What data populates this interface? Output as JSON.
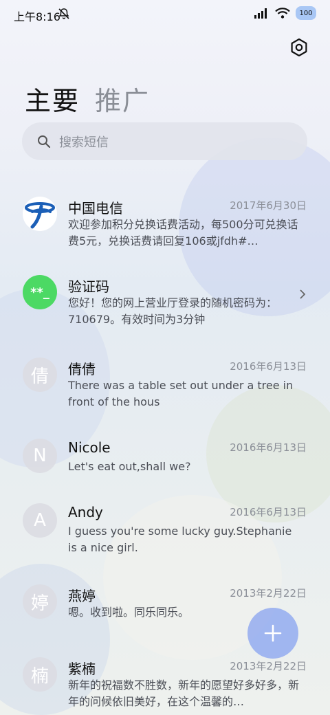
{
  "status_bar": {
    "time": "上午8:16",
    "battery": "100"
  },
  "tabs": [
    {
      "label": "主要"
    },
    {
      "label": "推广"
    }
  ],
  "search": {
    "placeholder": "搜索短信"
  },
  "conversations": [
    {
      "name": "中国电信",
      "date": "2017年6月30日",
      "preview": "欢迎参加积分兑换话费活动，每500分可兑换话费5元，兑换话费请回复106或jfdh#…",
      "avatar": "china-telecom-logo"
    },
    {
      "name": "验证码",
      "date": "",
      "preview": "您好！您的网上营业厅登录的随机密码为：710679。有效时间为3分钟",
      "avatar_text": "**_"
    },
    {
      "name": "倩倩",
      "date": "2016年6月13日",
      "preview": "There was a table set out under a tree in front of the hous",
      "avatar_text": "倩"
    },
    {
      "name": "Nicole",
      "date": "2016年6月13日",
      "preview": "Let's eat out,shall we?",
      "avatar_text": "N"
    },
    {
      "name": "Andy",
      "date": "2016年6月13日",
      "preview": "I guess you're some lucky guy.Stephanie is a nice girl.",
      "avatar_text": "A"
    },
    {
      "name": "燕婷",
      "date": "2013年2月22日",
      "preview": "嗯。收到啦。同乐同乐。",
      "avatar_text": "婷"
    },
    {
      "name": "紫楠",
      "date": "2013年2月22日",
      "preview": "新年的祝福数不胜数，新年的愿望好多好多，新年的问候依旧美好，在这个温馨的…",
      "avatar_text": "楠"
    }
  ],
  "colors": {
    "accent": "#7896f0",
    "verification_green": "#4cd964",
    "telecom_blue": "#1b5fb7"
  }
}
